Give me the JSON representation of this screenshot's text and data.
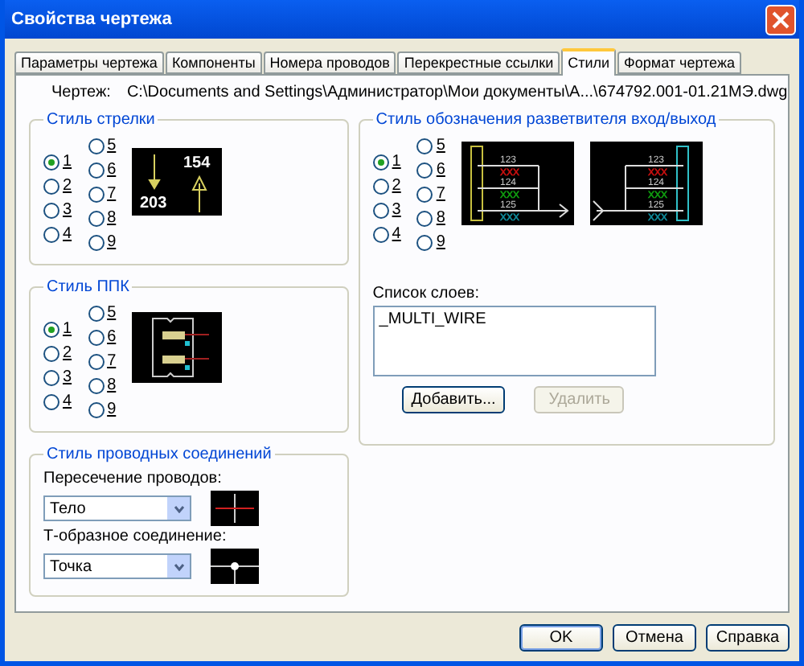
{
  "window": {
    "title": "Свойства чертежа"
  },
  "tabs": [
    {
      "label": "Параметры чертежа",
      "selected": false
    },
    {
      "label": "Компоненты",
      "selected": false
    },
    {
      "label": "Номера проводов",
      "selected": false
    },
    {
      "label": "Перекрестные ссылки",
      "selected": false
    },
    {
      "label": "Стили",
      "selected": true
    },
    {
      "label": "Формат чертежа",
      "selected": false
    }
  ],
  "drawing": {
    "label": "Чертеж:",
    "path": "C:\\Documents and Settings\\Администратор\\Мои документы\\А...\\674792.001-01.21МЭ.dwg"
  },
  "arrow_style": {
    "title": "Стиль стрелки",
    "options": [
      {
        "label": "1",
        "selected": true
      },
      {
        "label": "2",
        "selected": false
      },
      {
        "label": "3",
        "selected": false
      },
      {
        "label": "4",
        "selected": false
      },
      {
        "label": "5",
        "selected": false
      },
      {
        "label": "6",
        "selected": false
      },
      {
        "label": "7",
        "selected": false
      },
      {
        "label": "8",
        "selected": false
      },
      {
        "label": "9",
        "selected": false
      }
    ],
    "preview": {
      "down_label": "203",
      "up_label": "154"
    }
  },
  "ppk_style": {
    "title": "Стиль ППК",
    "options": [
      {
        "label": "1",
        "selected": true
      },
      {
        "label": "2",
        "selected": false
      },
      {
        "label": "3",
        "selected": false
      },
      {
        "label": "4",
        "selected": false
      },
      {
        "label": "5",
        "selected": false
      },
      {
        "label": "6",
        "selected": false
      },
      {
        "label": "7",
        "selected": false
      },
      {
        "label": "8",
        "selected": false
      },
      {
        "label": "9",
        "selected": false
      }
    ]
  },
  "wire_style": {
    "title": "Стиль проводных соединений",
    "crossing": {
      "label": "Пересечение проводов:",
      "value": "Тело"
    },
    "tee": {
      "label": "Т-образное соединение:",
      "value": "Точка"
    }
  },
  "splitter_style": {
    "title": "Стиль обозначения разветвителя вход/выход",
    "options": [
      {
        "label": "1",
        "selected": true
      },
      {
        "label": "2",
        "selected": false
      },
      {
        "label": "3",
        "selected": false
      },
      {
        "label": "4",
        "selected": false
      },
      {
        "label": "5",
        "selected": false
      },
      {
        "label": "6",
        "selected": false
      },
      {
        "label": "7",
        "selected": false
      },
      {
        "label": "8",
        "selected": false
      },
      {
        "label": "9",
        "selected": false
      }
    ],
    "previews": [
      {
        "kind": "input",
        "wires": [
          {
            "number": "123",
            "code": "XXX",
            "color": "#d01010"
          },
          {
            "number": "124",
            "code": "XXX",
            "color": "#10a010"
          },
          {
            "number": "125",
            "code": "XXX",
            "color": "#1090a0"
          }
        ]
      },
      {
        "kind": "output",
        "wires": [
          {
            "number": "123",
            "code": "XXX",
            "color": "#d01010"
          },
          {
            "number": "124",
            "code": "XXX",
            "color": "#10a010"
          },
          {
            "number": "125",
            "code": "XXX",
            "color": "#1090a0"
          }
        ]
      }
    ]
  },
  "layers": {
    "label": "Список слоев:",
    "items": [
      "_MULTI_WIRE"
    ],
    "buttons": [
      {
        "label": "Добавить...",
        "disabled": false
      },
      {
        "label": "Удалить",
        "disabled": true
      }
    ]
  },
  "footer_buttons": [
    {
      "label": "OK",
      "default": true
    },
    {
      "label": "Отмена",
      "default": false
    },
    {
      "label": "Справка",
      "default": false
    }
  ]
}
